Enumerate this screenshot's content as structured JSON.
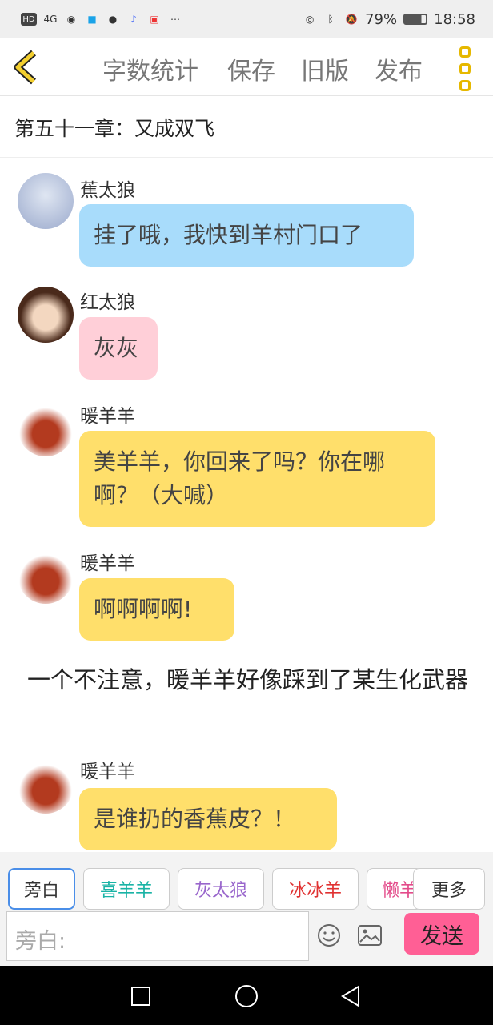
{
  "status": {
    "network": "4G",
    "battery": "79%",
    "time": "18:58"
  },
  "top_menu": [
    "字数统计",
    "保存",
    "旧版",
    "发布"
  ],
  "chapter_title": "第五十一章：又成双飞",
  "messages": [
    {
      "name": "蕉太狼",
      "text": "挂了哦，我快到羊村门口了",
      "color": "#a8dcfb"
    },
    {
      "name": "红太狼",
      "text": "灰灰",
      "color": "#ffcfd8"
    },
    {
      "name": "暖羊羊",
      "text": "美羊羊，你回来了吗？你在哪啊？（大喊）",
      "color": "#ffdf6b"
    },
    {
      "name": "暖羊羊",
      "text": "啊啊啊啊!",
      "color": "#ffdf6b"
    },
    {
      "name": "暖羊羊",
      "text": "是谁扔的香蕉皮？！",
      "color": "#ffdf6b"
    }
  ],
  "narration": "一个不注意，暖羊羊好像踩到了某生化武器",
  "characters": [
    {
      "label": "旁白",
      "color": "#333"
    },
    {
      "label": "喜羊羊",
      "color": "#19b3a5"
    },
    {
      "label": "灰太狼",
      "color": "#9966cc"
    },
    {
      "label": "冰冰羊",
      "color": "#e03232"
    },
    {
      "label": "懒羊",
      "color": "#e34b8a"
    }
  ],
  "more_label": "更多",
  "input_placeholder": "旁白:",
  "send_label": "发送",
  "accent": "#ff5f95"
}
